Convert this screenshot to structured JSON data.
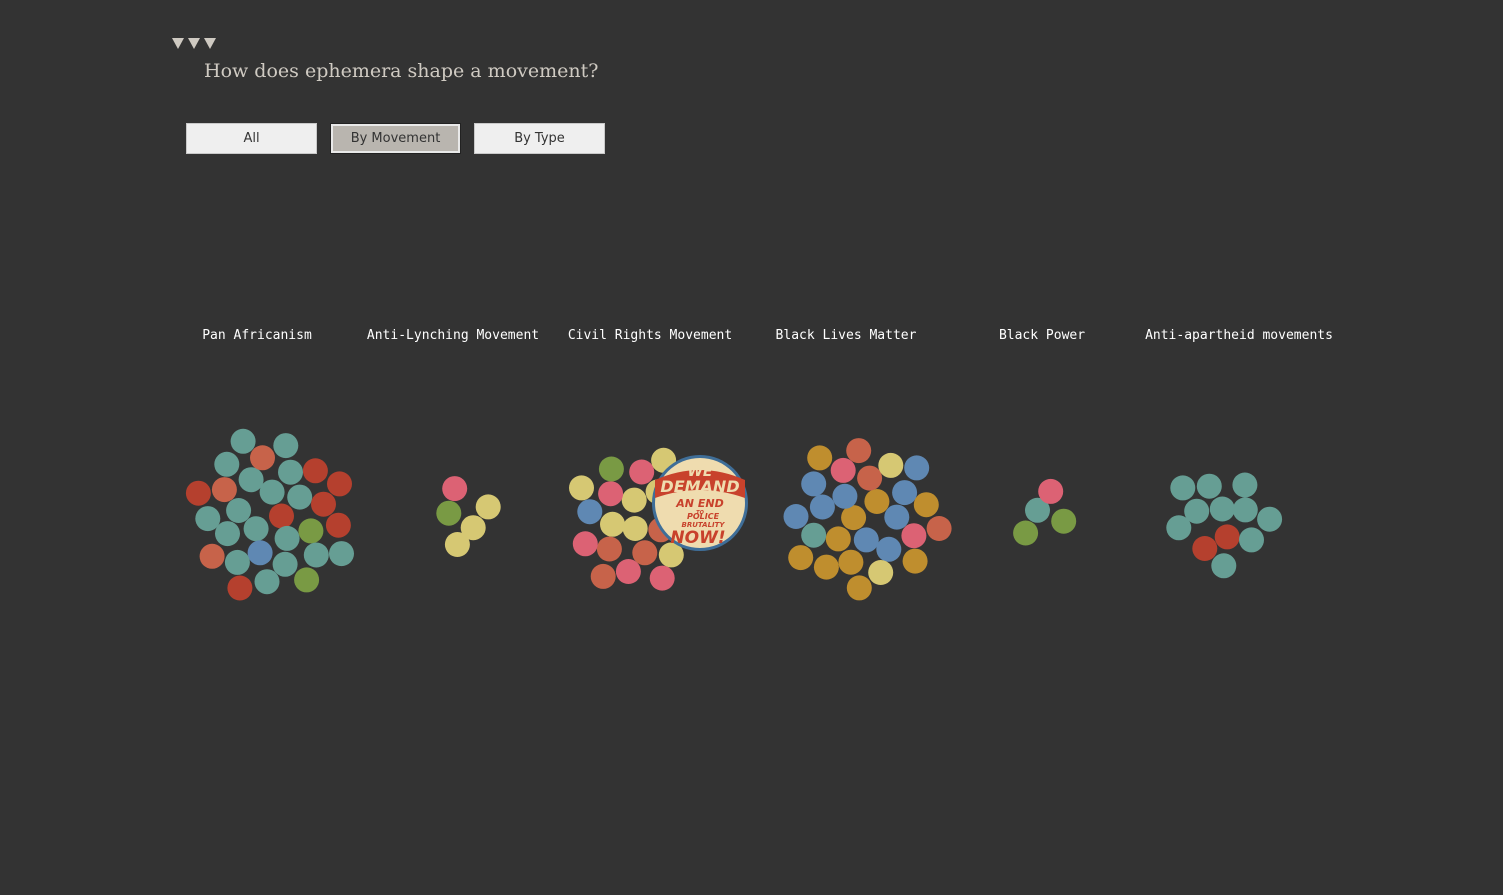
{
  "header": {
    "title": "How does ephemera shape a movement?"
  },
  "buttons": {
    "all": "All",
    "by_movement": "By Movement",
    "by_type": "By Type",
    "active": "By Movement"
  },
  "colors": {
    "background": "#333333",
    "teal": "#669e94",
    "red": "#b5402e",
    "orange": "#c7634a",
    "olive": "#799a44",
    "yellow": "#d6c873",
    "pink": "#dc6274",
    "blue": "#5f88b3",
    "mustard": "#bf8e2e"
  },
  "featured": {
    "movement": "Civil Rights Movement",
    "text_line1": "WE",
    "text_line2": "DEMAND",
    "text_line3": "AN END",
    "text_line4": "TO",
    "text_line5": "POLICE",
    "text_line6": "BRUTALITY",
    "text_line7": "NOW!"
  },
  "chart_data": {
    "type": "scatter",
    "clusters": [
      {
        "name": "Pan Africanism",
        "counts": {
          "teal": 17,
          "red": 7,
          "orange": 3,
          "olive": 2,
          "blue": 1
        }
      },
      {
        "name": "Anti-Lynching Movement",
        "counts": {
          "yellow": 3,
          "olive": 1,
          "pink": 1
        }
      },
      {
        "name": "Civil Rights Movement",
        "counts": {
          "yellow": 8,
          "pink": 5,
          "orange": 6,
          "olive": 1,
          "blue": 2
        }
      },
      {
        "name": "Black Lives Matter",
        "counts": {
          "blue": 9,
          "mustard": 10,
          "yellow": 2,
          "orange": 3,
          "pink": 2,
          "teal": 1
        }
      },
      {
        "name": "Black Power",
        "counts": {
          "teal": 1,
          "pink": 1,
          "olive": 2
        }
      },
      {
        "name": "Anti-apartheid movements",
        "counts": {
          "teal": 10,
          "red": 2
        }
      }
    ]
  }
}
